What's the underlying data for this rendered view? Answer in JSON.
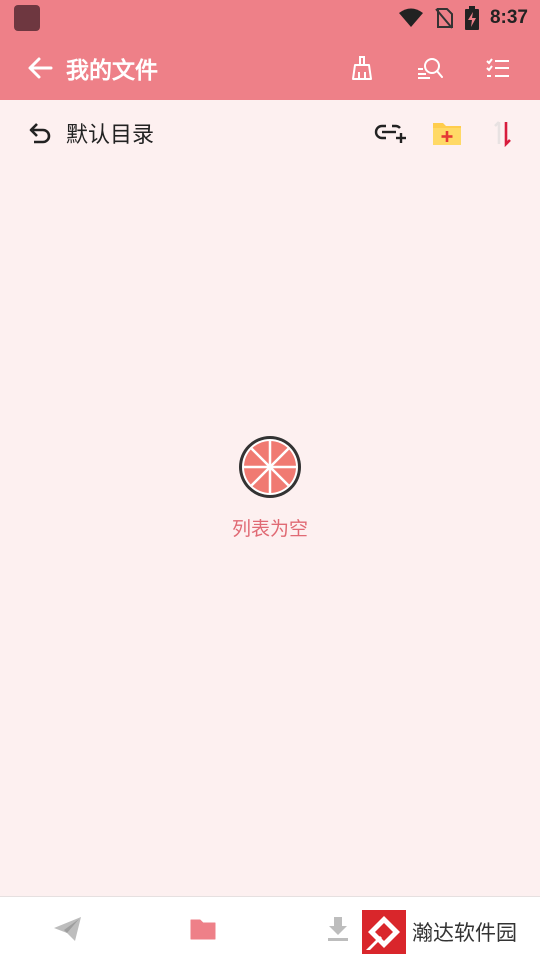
{
  "status_bar": {
    "time": "8:37"
  },
  "toolbar": {
    "title": "我的文件",
    "icons": [
      "clean-icon",
      "search-file-icon",
      "checklist-icon"
    ]
  },
  "path_bar": {
    "label": "默认目录",
    "icons": [
      "link-add-icon",
      "new-folder-icon",
      "sort-icon"
    ]
  },
  "empty_state": {
    "message": "列表为空",
    "icon": "grapefruit-icon"
  },
  "bottom_nav": {
    "items": [
      "send-icon",
      "folder-icon",
      "download-icon"
    ],
    "active": 1
  },
  "watermark": {
    "text": "瀚达软件园"
  },
  "colors": {
    "primary": "#ee8088",
    "background": "#fdf0f0",
    "accent_text": "#e06a74",
    "folder_yellow": "#ffcd4d",
    "sort_red": "#d81b3c"
  }
}
